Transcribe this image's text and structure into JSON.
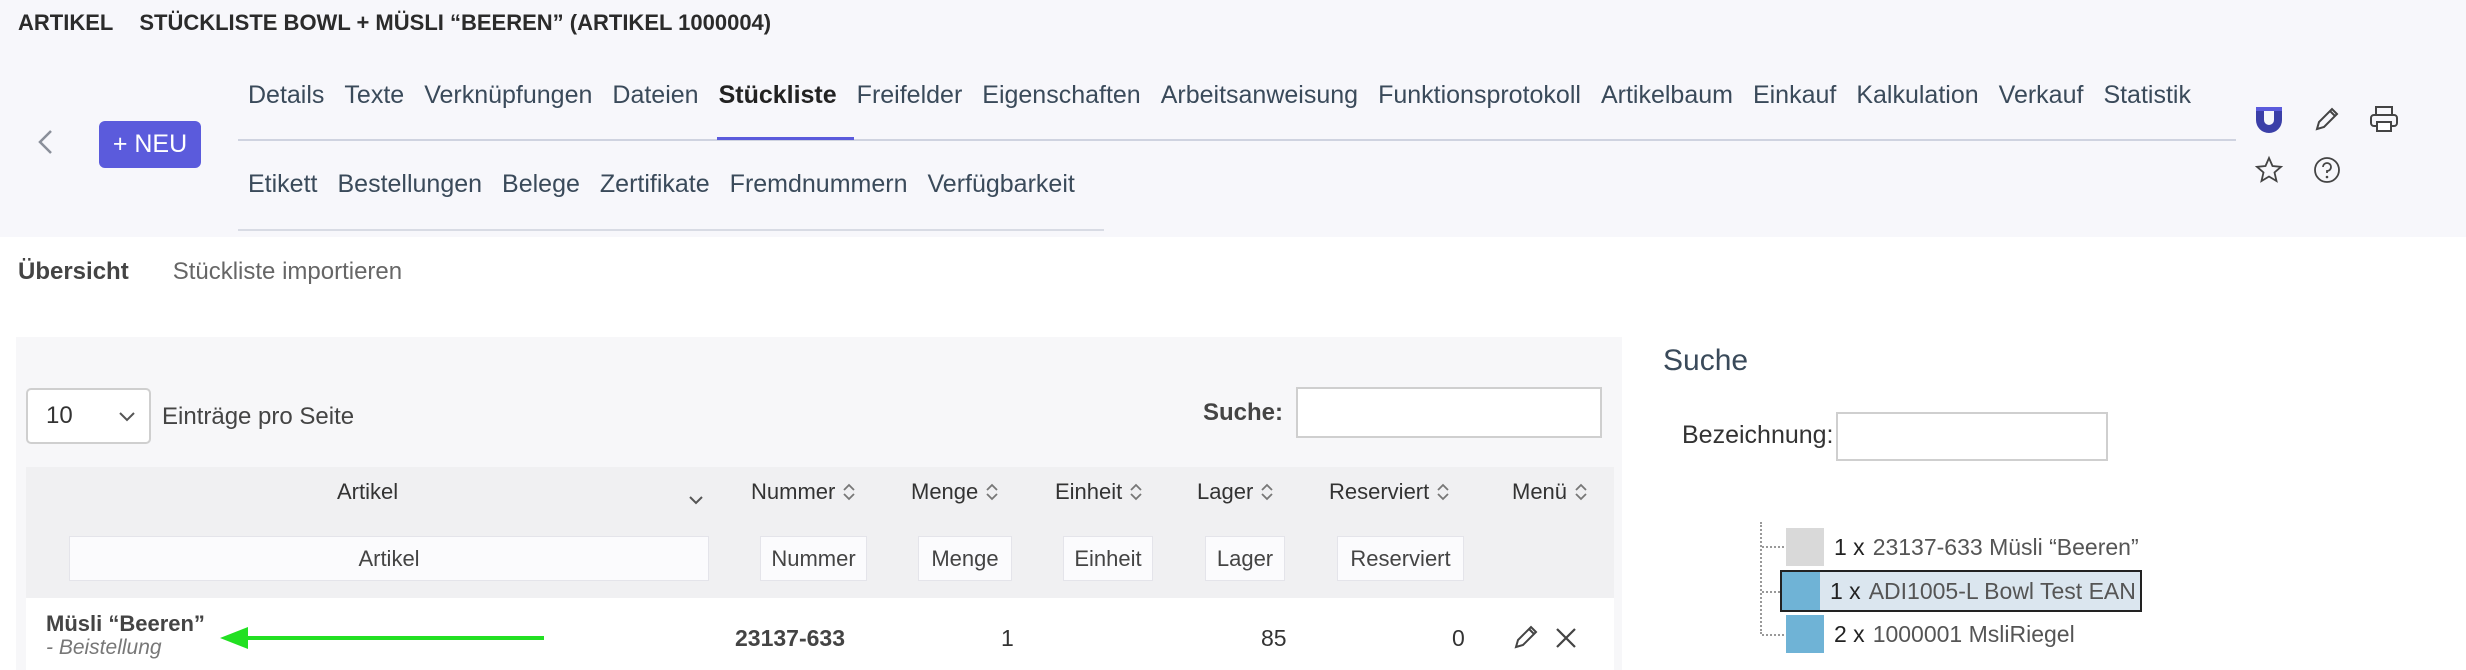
{
  "breadcrumb": {
    "section": "ARTIKEL",
    "title": "STÜCKLISTE BOWL + MÜSLI “BEEREN” (ARTIKEL 1000004)"
  },
  "toolbar": {
    "new_label": "+ NEU"
  },
  "tabs_row1": [
    "Details",
    "Texte",
    "Verknüpfungen",
    "Dateien",
    "Stückliste",
    "Freifelder",
    "Eigenschaften",
    "Arbeitsanweisung",
    "Funktionsprotokoll",
    "Artikelbaum",
    "Einkauf",
    "Kalkulation",
    "Verkauf",
    "Statistik"
  ],
  "tabs_row2": [
    "Etikett",
    "Bestellungen",
    "Belege",
    "Zertifikate",
    "Fremdnummern",
    "Verfügbarkeit"
  ],
  "active_tab": "Stückliste",
  "subnav": {
    "overview": "Übersicht",
    "import": "Stückliste importieren"
  },
  "table": {
    "length_value": "10",
    "length_label": "Einträge pro Seite",
    "search_label": "Suche:",
    "columns": [
      "Artikel",
      "Nummer",
      "Menge",
      "Einheit",
      "Lager",
      "Reserviert",
      "Menü"
    ],
    "filters": [
      "Artikel",
      "Nummer",
      "Menge",
      "Einheit",
      "Lager",
      "Reserviert"
    ],
    "rows": [
      {
        "artikel": "Müsli “Beeren”",
        "note": "- Beistellung",
        "nummer": "23137-633",
        "menge": "1",
        "einheit": "",
        "lager": "85",
        "reserviert": "0"
      }
    ]
  },
  "side": {
    "title": "Suche",
    "bezeichnung_label": "Bezeichnung:",
    "tree": [
      {
        "qty": "1 x",
        "desc": "23137-633 Müsli “Beeren”",
        "color": "#d9d9d9"
      },
      {
        "qty": "1 x",
        "desc": "ADI1005-L Bowl Test EAN",
        "color": "#6fb3d6",
        "selected": true
      },
      {
        "qty": "2 x",
        "desc": "1000001 MsliRiegel",
        "color": "#6fb3d6"
      }
    ]
  },
  "colors": {
    "accent": "#5b5bdc",
    "arrow": "#22e022",
    "brand_icon": "#3b3fa8"
  }
}
